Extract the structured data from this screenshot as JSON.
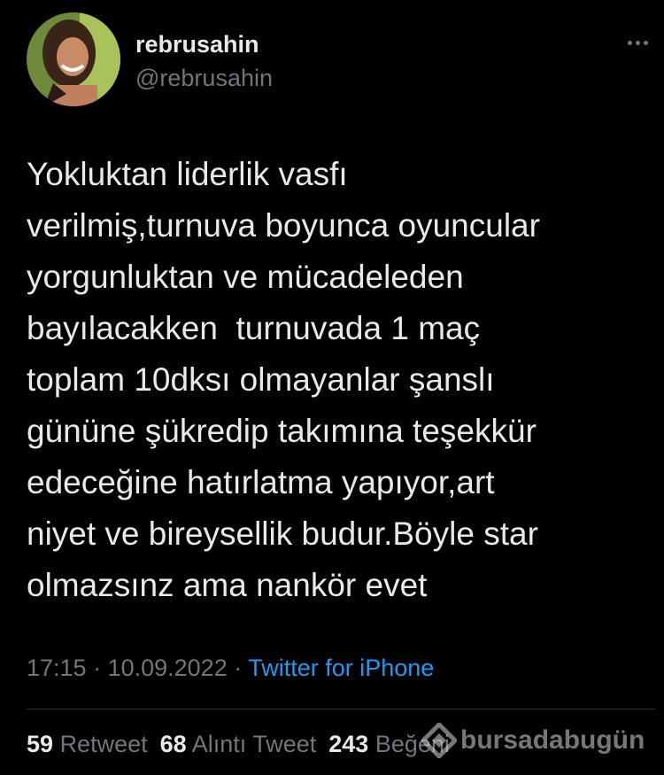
{
  "author": {
    "display_name": "rebrusahin",
    "handle": "@rebrusahin"
  },
  "tweet": {
    "lines": [
      "Yokluktan liderlik vasfı",
      "verilmiş,turnuva boyunca oyuncular",
      "yorgunluktan ve mücadeleden",
      "bayılacakken  turnuvada 1 maç",
      "toplam 10dksı olmayanlar şanslı",
      "gününe şükredip takımına teşekkür",
      "edeceğine hatırlatma yapıyor,art",
      "niyet ve bireysellik budur.Böyle star",
      "olmazsınz ama nankör evet"
    ],
    "time": "17:15",
    "date": "10.09.2022",
    "separator": " · ",
    "source": "Twitter for iPhone"
  },
  "stats": {
    "retweets": {
      "count": "59",
      "label": "Retweet"
    },
    "quotes": {
      "count": "68",
      "label": "Alıntı Tweet"
    },
    "likes": {
      "count": "243",
      "label": "Beğeni"
    }
  },
  "watermark": {
    "text": "bursadabugün"
  },
  "icons": {
    "more": "more-horizontal-icon",
    "watermark": "diamond-logo-icon"
  },
  "colors": {
    "background": "#000000",
    "text": "#e7e9ea",
    "muted": "#71767b",
    "link": "#1d9bf0",
    "divider": "#2f3336"
  }
}
